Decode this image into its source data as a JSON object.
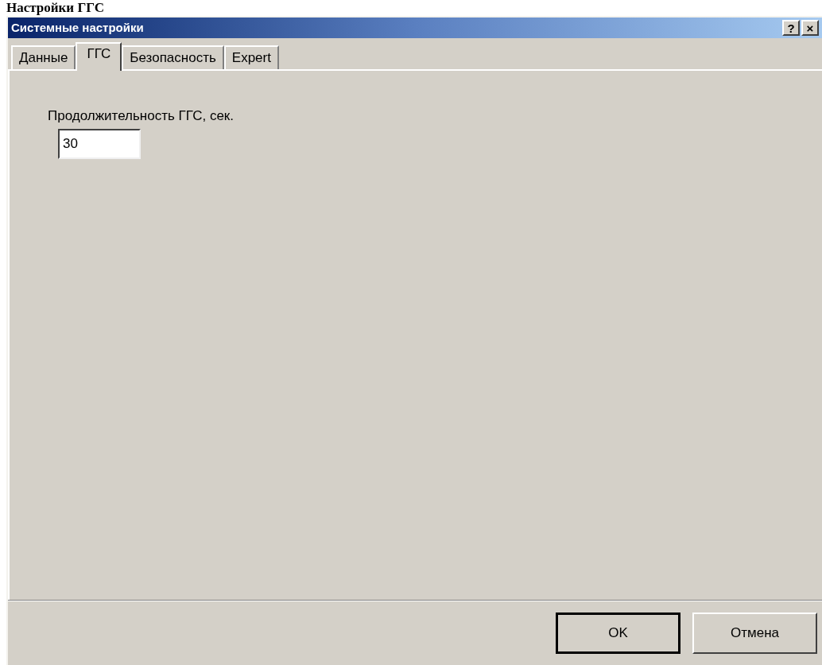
{
  "page_heading": "Настройки ГГС",
  "window": {
    "title": "Системные настройки",
    "controls": [
      "?",
      "×"
    ]
  },
  "tabs": [
    {
      "label": "Данные",
      "selected": false
    },
    {
      "label": "ГГС",
      "selected": true
    },
    {
      "label": "Безопасность",
      "selected": false
    },
    {
      "label": "Expert",
      "selected": false
    }
  ],
  "field": {
    "label": "Продолжительность ГГС, сек.",
    "value": "30"
  },
  "buttons": [
    {
      "label": "OK",
      "default": true
    },
    {
      "label": "Отмена",
      "default": false
    }
  ]
}
